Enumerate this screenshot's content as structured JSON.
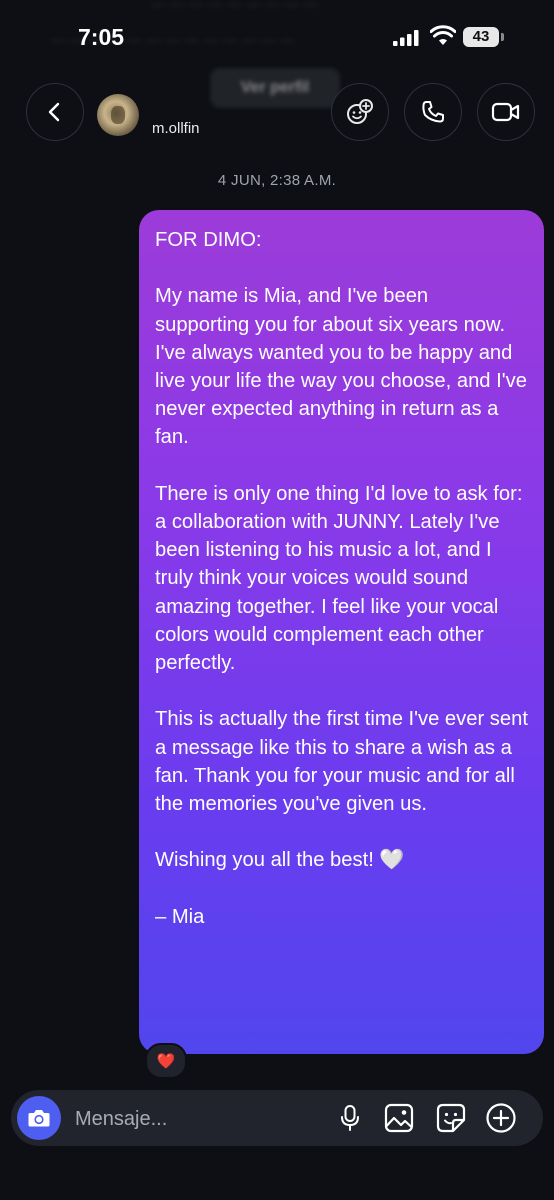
{
  "status_bar": {
    "time": "7:05",
    "battery": "43",
    "blurred_top": "— — — — — — — — —",
    "blurred_line": "— — — — — — — — — — — — —"
  },
  "header": {
    "username": "m.ollfin",
    "view_profile": "Ver perfil",
    "icons": [
      "back-icon",
      "add-friend-icon",
      "phone-icon",
      "video-camera-icon"
    ]
  },
  "chat": {
    "timestamp": "4 JUN, 2:38 A.M.",
    "message": {
      "p1": "FOR DIMO:",
      "p2": "My name is Mia, and I've been supporting you for about six years now. I've always wanted you to be happy and live your life the way you choose, and I've never expected anything in return as a fan.",
      "p3": "There is only one thing I'd love to ask for: a collaboration with JUNNY. Lately I've been listening to his music a lot, and I truly think your voices would sound amazing together. I feel like your vocal colors would complement each other perfectly.",
      "p4": "This is actually the first time I've ever sent a message like this to share a wish as a fan. Thank you for your music and for all the memories you've given us.",
      "p5": "Wishing you all the best!",
      "p5_emoji": "🤍",
      "p6": "– Mia"
    },
    "reaction": "❤️",
    "bubble_colors": {
      "top": "#9c3bd9",
      "bottom": "#5146ee"
    }
  },
  "composer": {
    "placeholder": "Mensaje...",
    "value": "",
    "accent": "#4d5ef0",
    "icons": [
      "camera-icon",
      "microphone-icon",
      "image-icon",
      "sticker-icon",
      "plus-icon"
    ]
  }
}
